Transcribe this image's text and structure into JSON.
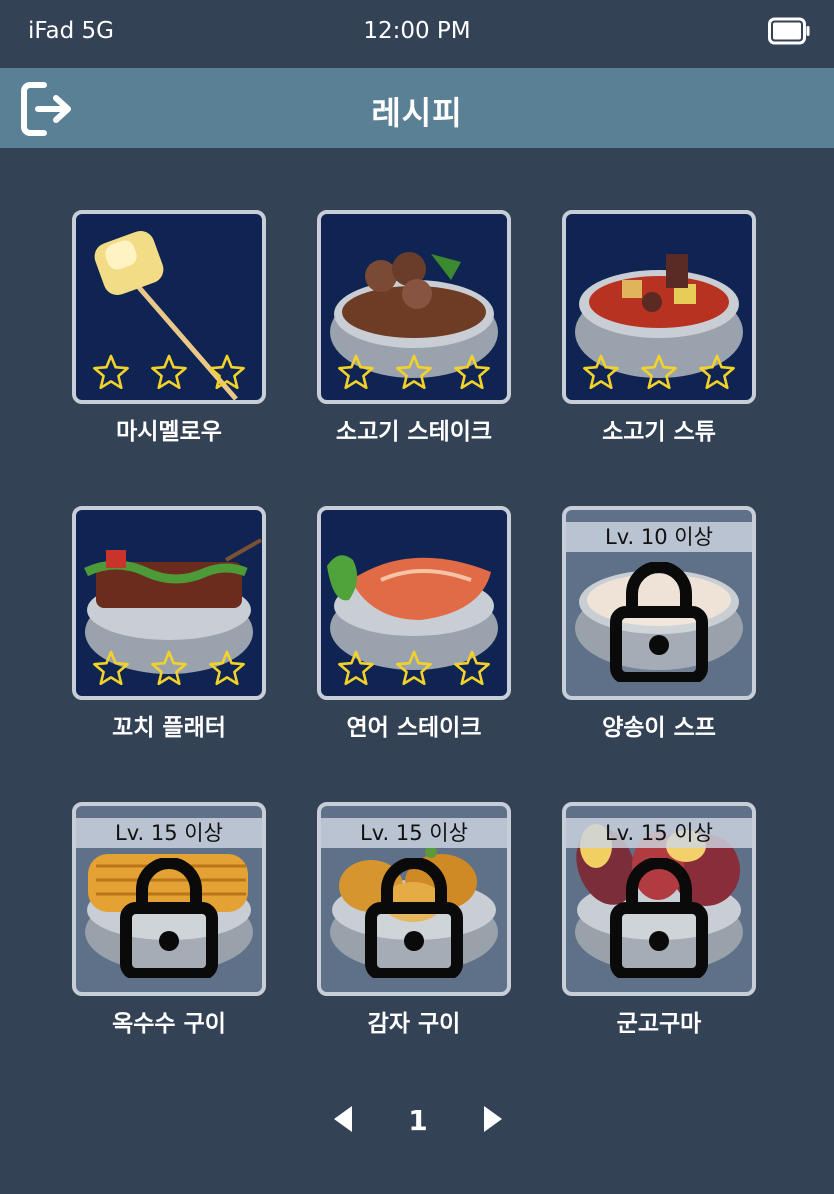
{
  "status_bar": {
    "carrier": "iFad 5G",
    "time": "12:00 PM",
    "battery_icon": "battery-full-icon"
  },
  "header": {
    "title": "레시피",
    "exit_icon": "exit-icon"
  },
  "colors": {
    "background": "#344256",
    "header": "#5a8096",
    "card_bg": "#0f2452",
    "locked_bg": "#5f7189",
    "star": "#f2d22a"
  },
  "recipes": [
    {
      "name": "마시멜로우",
      "stars": 3,
      "locked": false,
      "image": "marshmallow-skewer-image"
    },
    {
      "name": "소고기 스테이크",
      "stars": 3,
      "locked": false,
      "image": "beef-steak-image"
    },
    {
      "name": "소고기 스튜",
      "stars": 3,
      "locked": false,
      "image": "beef-stew-image"
    },
    {
      "name": "꼬치 플래터",
      "stars": 3,
      "locked": false,
      "image": "skewer-platter-image"
    },
    {
      "name": "연어 스테이크",
      "stars": 3,
      "locked": false,
      "image": "salmon-steak-image"
    },
    {
      "name": "양송이 스프",
      "stars": 0,
      "locked": true,
      "level": "Lv. 10 이상",
      "image": "mushroom-soup-image"
    },
    {
      "name": "옥수수 구이",
      "stars": 0,
      "locked": true,
      "level": "Lv. 15 이상",
      "image": "grilled-corn-image"
    },
    {
      "name": "감자 구이",
      "stars": 0,
      "locked": true,
      "level": "Lv. 15 이상",
      "image": "baked-potato-image"
    },
    {
      "name": "군고구마",
      "stars": 0,
      "locked": true,
      "level": "Lv. 15 이상",
      "image": "roasted-sweet-potato-image"
    }
  ],
  "pagination": {
    "current_page": "1",
    "prev_icon": "triangle-left-icon",
    "next_icon": "triangle-right-icon"
  }
}
